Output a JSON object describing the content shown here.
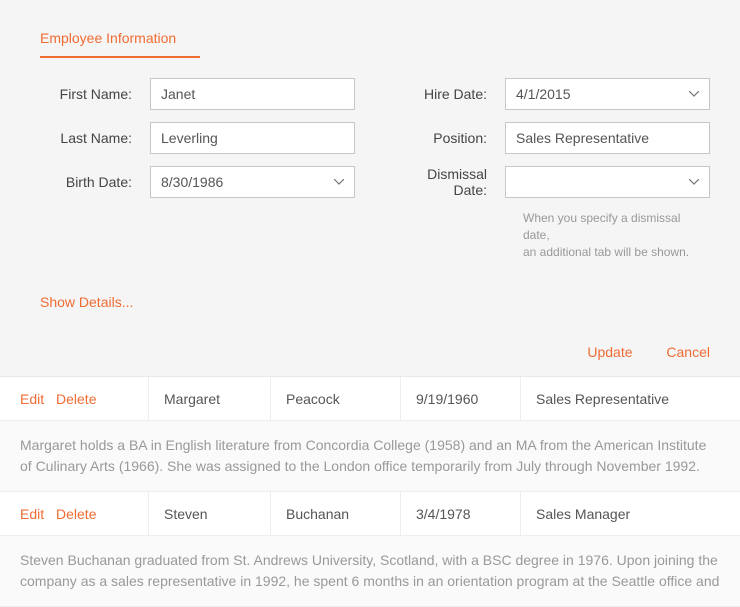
{
  "tab_title": "Employee Information",
  "form": {
    "first_name": {
      "label": "First Name:",
      "value": "Janet"
    },
    "last_name": {
      "label": "Last Name:",
      "value": "Leverling"
    },
    "birth_date": {
      "label": "Birth Date:",
      "value": "8/30/1986"
    },
    "hire_date": {
      "label": "Hire Date:",
      "value": "4/1/2015"
    },
    "position": {
      "label": "Position:",
      "value": "Sales Representative"
    },
    "dismissal_date": {
      "label": "Dismissal Date:",
      "value": ""
    }
  },
  "hint_line1": "When you specify a dismissal date,",
  "hint_line2": "an additional tab will be shown.",
  "show_details": "Show Details...",
  "buttons": {
    "update": "Update",
    "cancel": "Cancel"
  },
  "row_actions": {
    "edit": "Edit",
    "delete": "Delete"
  },
  "rows": [
    {
      "first_name": "Margaret",
      "last_name": "Peacock",
      "date": "9/19/1960",
      "position": "Sales Representative",
      "bio": "Margaret holds a BA in English literature from Concordia College (1958) and an MA from the American Institute of Culinary Arts (1966). She was assigned to the London office temporarily from July through November 1992."
    },
    {
      "first_name": "Steven",
      "last_name": "Buchanan",
      "date": "3/4/1978",
      "position": "Sales Manager",
      "bio": "Steven Buchanan graduated from St. Andrews University, Scotland, with a BSC degree in 1976. Upon joining the company as a sales representative in 1992, he spent 6 months in an orientation program at the Seattle office and"
    }
  ]
}
